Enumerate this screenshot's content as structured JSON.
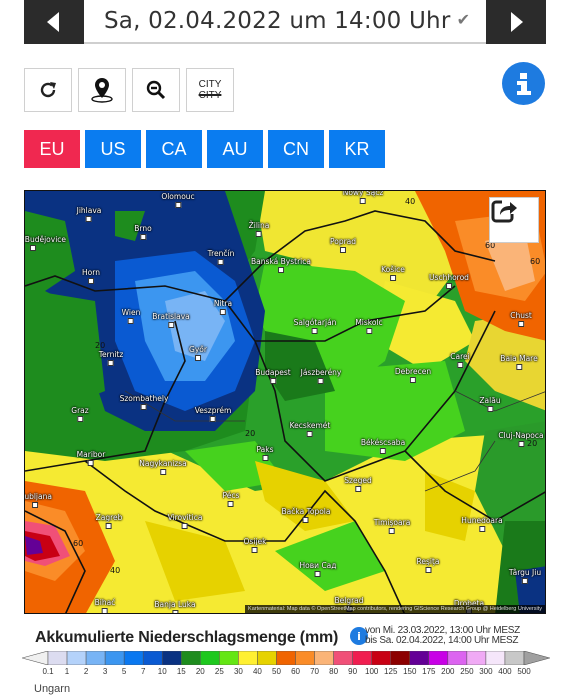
{
  "header": {
    "prev_label": "previous",
    "date_value": "Sa, 02.04.2022 um 14:00 Uhr",
    "next_label": "next"
  },
  "toolbar": {
    "items": [
      {
        "name": "refresh",
        "icon": "refresh-icon"
      },
      {
        "name": "location",
        "icon": "location-pin-icon"
      },
      {
        "name": "zoom-out",
        "icon": "zoom-out-icon"
      },
      {
        "name": "city-toggle",
        "icon": "city-toggle-icon",
        "label_top": "CITY",
        "label_bottom": "CITY"
      }
    ],
    "info_icon": "info-icon"
  },
  "regions": {
    "items": [
      {
        "label": "EU",
        "active": true
      },
      {
        "label": "US",
        "active": false
      },
      {
        "label": "CA",
        "active": false
      },
      {
        "label": "AU",
        "active": false
      },
      {
        "label": "CN",
        "active": false
      },
      {
        "label": "KR",
        "active": false
      }
    ],
    "active_color": "#f02850",
    "default_color": "#0a7cf0"
  },
  "map": {
    "cities": [
      "Olomouc",
      "Jihlava",
      "Brno",
      "České Budějovice",
      "Horn",
      "Wien",
      "Bratislava",
      "Nitra",
      "Trenčín",
      "Žilina",
      "Banská Bystrica",
      "Poprad",
      "Nowy Sącz",
      "Košice",
      "Uschhorod",
      "Chust",
      "Salgótarján",
      "Miskolc",
      "Ternitz",
      "Győr",
      "Budapest",
      "Jászberény",
      "Debrecen",
      "Carei",
      "Baia Mare",
      "Szombathely",
      "Veszprém",
      "Graz",
      "Zalău",
      "Kecskemét",
      "Cluj-Napoca",
      "Maribor",
      "Nagykanizsa",
      "Paks",
      "Békéscsaba",
      "Ljubljana",
      "Pécs",
      "Szeged",
      "Zagreb",
      "Virovitica",
      "Bačka Topola",
      "Timişoara",
      "Hunedoara",
      "Osijek",
      "Нови Сад",
      "Reşiţa",
      "Târgu Jiu",
      "Bihać",
      "Banja Luka",
      "Belgrad",
      "Drobeta"
    ],
    "contour_labels": [
      "20",
      "20",
      "20",
      "40",
      "40",
      "60",
      "60",
      "60"
    ],
    "share_icon": "share-icon",
    "attribution": "Kartenmaterial: Map data © OpenStreetMap contributors, rendering GIScience Research Group @ Heidelberg University"
  },
  "legend": {
    "title": "Akkumulierte Niederschlagsmenge (mm)",
    "range_line1": "von Mi. 23.03.2022, 13:00 Uhr MESZ",
    "range_line2": "bis Sa. 02.04.2022, 14:00 Uhr MESZ",
    "ticks": [
      "0.1",
      "1",
      "2",
      "3",
      "5",
      "7",
      "10",
      "15",
      "20",
      "25",
      "30",
      "40",
      "50",
      "60",
      "70",
      "80",
      "90",
      "100",
      "125",
      "150",
      "175",
      "200",
      "250",
      "300",
      "400",
      "500"
    ],
    "colors": [
      "#dcdcf0",
      "#b4d2fa",
      "#78b4f5",
      "#3c96f0",
      "#0a78f0",
      "#0a5ad2",
      "#0a3282",
      "#1e8c1e",
      "#1ec81e",
      "#64e614",
      "#fff032",
      "#e6d200",
      "#f06400",
      "#fa8c28",
      "#fab478",
      "#f05078",
      "#f01e50",
      "#c80014",
      "#8c0000",
      "#640096",
      "#c800e6",
      "#dc64f0",
      "#f0aaf5",
      "#f5e6fa",
      "#c8c8c8"
    ],
    "low_color": "#f0f0f0",
    "high_color": "#a0a0a0"
  },
  "footer": {
    "text": "Ungarn"
  }
}
